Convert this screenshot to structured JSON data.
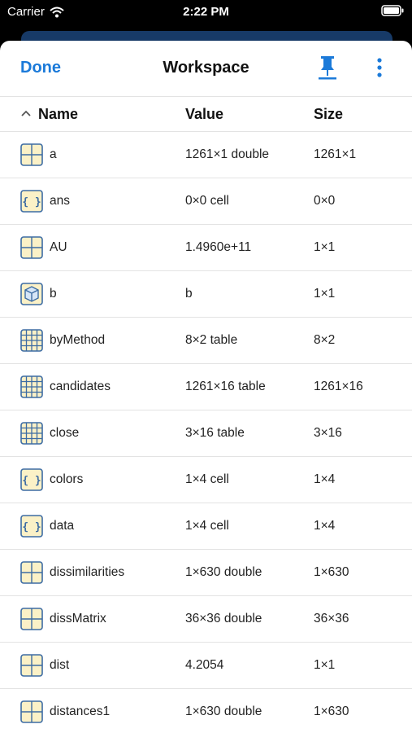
{
  "status": {
    "carrier": "Carrier",
    "time": "2:22 PM"
  },
  "nav": {
    "done_label": "Done",
    "title": "Workspace"
  },
  "columns": {
    "name": "Name",
    "value": "Value",
    "size": "Size"
  },
  "colors": {
    "accent": "#1b7ad9",
    "icon_fill": "#fbf1c7",
    "icon_stroke": "#3d6ca3"
  },
  "variables": [
    {
      "name": "a",
      "value": "1261×1 double",
      "size": "1261×1",
      "icon": "matrix-icon"
    },
    {
      "name": "ans",
      "value": "0×0 cell",
      "size": "0×0",
      "icon": "cell-icon"
    },
    {
      "name": "AU",
      "value": "1.4960e+11",
      "size": "1×1",
      "icon": "matrix-icon"
    },
    {
      "name": "b",
      "value": "b",
      "size": "1×1",
      "icon": "object-icon"
    },
    {
      "name": "byMethod",
      "value": "8×2 table",
      "size": "8×2",
      "icon": "table-icon"
    },
    {
      "name": "candidates",
      "value": "1261×16 table",
      "size": "1261×16",
      "icon": "table-icon"
    },
    {
      "name": "close",
      "value": "3×16 table",
      "size": "3×16",
      "icon": "table-icon"
    },
    {
      "name": "colors",
      "value": "1×4 cell",
      "size": "1×4",
      "icon": "cell-icon"
    },
    {
      "name": "data",
      "value": "1×4 cell",
      "size": "1×4",
      "icon": "cell-icon"
    },
    {
      "name": "dissimilarities",
      "value": "1×630 double",
      "size": "1×630",
      "icon": "matrix-icon"
    },
    {
      "name": "dissMatrix",
      "value": "36×36 double",
      "size": "36×36",
      "icon": "matrix-icon"
    },
    {
      "name": "dist",
      "value": "4.2054",
      "size": "1×1",
      "icon": "matrix-icon"
    },
    {
      "name": "distances1",
      "value": "1×630 double",
      "size": "1×630",
      "icon": "matrix-icon"
    }
  ]
}
